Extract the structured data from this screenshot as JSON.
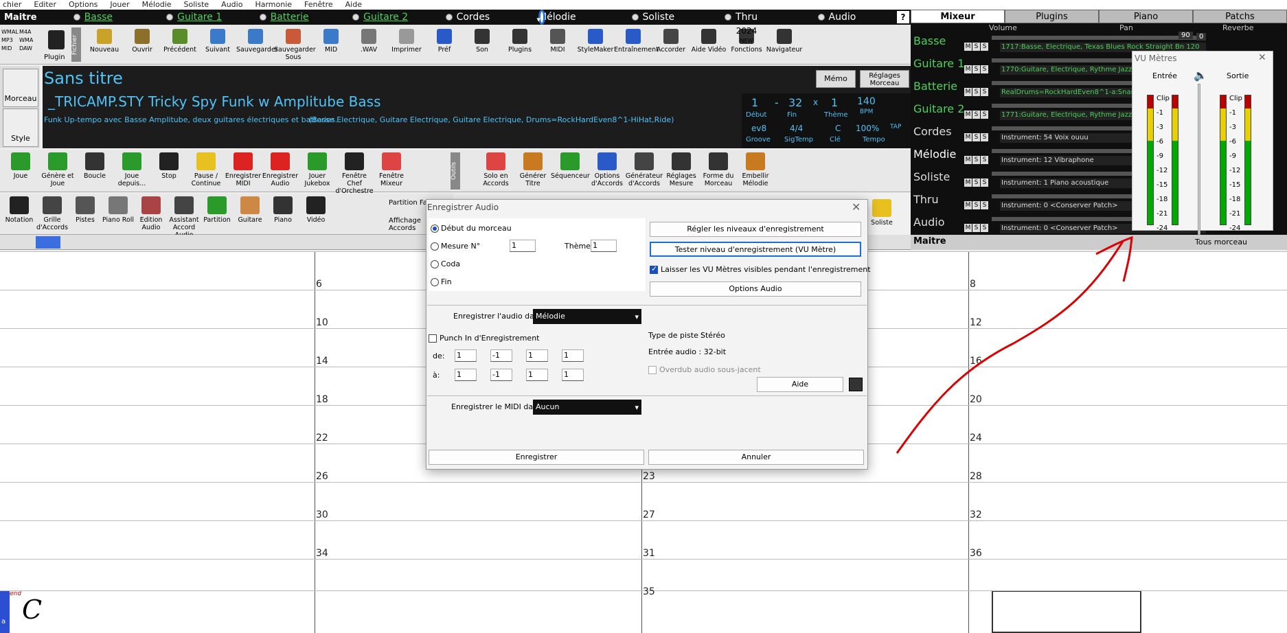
{
  "menu": [
    "chier",
    "Editer",
    "Options",
    "Jouer",
    "Mélodie",
    "Soliste",
    "Audio",
    "Harmonie",
    "Fenêtre",
    "Aide"
  ],
  "tracks": {
    "first": "Maitre",
    "items": [
      {
        "label": "Basse",
        "color": "green",
        "selected": false
      },
      {
        "label": "Guitare 1",
        "color": "green",
        "selected": false
      },
      {
        "label": "Batterie",
        "color": "green",
        "selected": false
      },
      {
        "label": "Guitare 2",
        "color": "green",
        "selected": false
      },
      {
        "label": "Cordes",
        "color": "white",
        "selected": false
      },
      {
        "label": "Mélodie",
        "color": "white",
        "selected": true
      },
      {
        "label": "Soliste",
        "color": "white",
        "selected": false
      },
      {
        "label": "Thru",
        "color": "white",
        "selected": false
      },
      {
        "label": "Audio",
        "color": "white",
        "selected": false
      }
    ],
    "help": "?"
  },
  "toolbar1": {
    "left": [
      "WMAL",
      "M4A",
      "MP3",
      "WMA",
      "MID",
      "DAW"
    ],
    "plugin_label": "Plugin",
    "fichier": "Fichier",
    "buttons": [
      "Nouveau",
      "Ouvrir",
      "Précédent",
      "Suivant",
      "Sauvegarder",
      "Sauvegarder Sous",
      "MID",
      ".WAV",
      "Imprimer",
      "Préf",
      "Son",
      "Plugins",
      "MIDI",
      "StyleMaker",
      "Entraînement",
      "Accorder",
      "Aide Vidéo",
      "Fonctions",
      "Navigateur"
    ],
    "fonctions_year": "2024",
    "fonctions_new": "NEW"
  },
  "song": {
    "title": "Sans titre",
    "style": "_TRICAMP.STY Tricky Spy Funk w Amplitube Bass",
    "desc": "Funk Up-tempo avec Basse Amplitube, deux guitares électriques et batteries.",
    "desc2": "(Basse Electrique, Guitare Electrique, Guitare Electrique, Drums=RockHardEven8^1-HiHat,Ride)",
    "memo": "Mémo",
    "reglages": "Réglages Morceau",
    "start": "1",
    "dash": "-",
    "end": "32",
    "x": "x",
    "theme_count": "1",
    "start_label": "Début",
    "end_label": "Fin",
    "theme_label": "Thème",
    "groove": "ev8",
    "sig": "4/4",
    "key": "C",
    "groove_label": "Groove",
    "sig_label": "SigTemp",
    "key_label": "Clé",
    "tempo": "140",
    "bpm": "BPM",
    "percent": "100%",
    "tap": "TAP",
    "tempo_label": "Tempo"
  },
  "sidebar": {
    "morceau": "Morceau",
    "style": "Style"
  },
  "toolbar2": [
    "Joue",
    "Génère et Joue",
    "Boucle",
    "Joue depuis...",
    "Stop",
    "Pause / Continue",
    "Enregistrer MIDI",
    "Enregistrer Audio",
    "Jouer Jukebox",
    "Fenêtre Chef d'Orchestre",
    "Fenêtre Mixeur",
    "Outils",
    "Solo en Accords",
    "Générer Titre",
    "Séquenceur",
    "Options d'Accords",
    "Générateur d'Accords",
    "Réglages Mesure",
    "Forme du Morceau",
    "Embellir Mélodie"
  ],
  "toolbar3": [
    "Notation",
    "Grille d'Accords",
    "Pistes",
    "Piano Roll",
    "Edition Audio",
    "Assistant Accord Audio",
    "Partition",
    "Guitare",
    "Piano",
    "Vidéo",
    "Partition Fal",
    "Affichage Accords",
    "Soliste"
  ],
  "grid": {
    "bars_col1": [
      "6",
      "10",
      "14",
      "18",
      "22",
      "26",
      "30",
      "34"
    ],
    "bars_col3": [
      "8",
      "12",
      "16",
      "20",
      "24",
      "28",
      "32",
      "36"
    ],
    "bars_mid": [
      "23",
      "27",
      "31",
      "35"
    ],
    "end_marker": "end",
    "chord": "C",
    "corner": "a"
  },
  "mixer": {
    "tabs": [
      "Mixeur",
      "Plugins",
      "Piano",
      "Patchs"
    ],
    "headers": [
      "Volume",
      "Pan",
      "Reverbe"
    ],
    "rows": [
      {
        "name": "Basse",
        "color": "#4cd15a",
        "vol": "90",
        "inst": "1717:Basse, Electrique, Texas Blues Rock Straight Bn 120"
      },
      {
        "name": "Guitare 1",
        "color": "#4cd15a",
        "vol": "90",
        "inst": "1770:Guitare, Electrique, Rythme Jazz"
      },
      {
        "name": "Batterie",
        "color": "#4cd15a",
        "vol": "90",
        "inst": "RealDrums=RockHardEven8^1-a:Snare"
      },
      {
        "name": "Guitare 2",
        "color": "#4cd15a",
        "vol": "90",
        "inst": "1771:Guitare, Electrique, Rythme Jazz"
      },
      {
        "name": "Cordes",
        "color": "#dddddd",
        "vol": "90",
        "inst": "Instrument: 54 Voix ouuu"
      },
      {
        "name": "Mélodie",
        "color": "#ffffff",
        "vol": "90",
        "inst": "Instrument: 12 Vibraphone"
      },
      {
        "name": "Soliste",
        "color": "#dddddd",
        "vol": "90",
        "inst": "Instrument: 1 Piano acoustique"
      },
      {
        "name": "Thru",
        "color": "#dddddd",
        "vol": "90",
        "inst": "Instrument: 0 <Conserver Patch>"
      },
      {
        "name": "Audio",
        "color": "#dddddd",
        "vol": "90",
        "inst": "Instrument: 0 <Conserver Patch>"
      }
    ],
    "master": "Maitre",
    "master_extra": "Tous morceau",
    "rev_val": "0",
    "msh": [
      "M",
      "S",
      "S"
    ]
  },
  "vu": {
    "title": "VU Mètres",
    "close": "✕",
    "in_label": "Entrée",
    "out_label": "Sortie",
    "ticks": [
      "Clip",
      "-1",
      "-3",
      "-6",
      "-9",
      "-12",
      "-15",
      "-18",
      "-21",
      "-24"
    ]
  },
  "dialog": {
    "title": "Enregistrer Audio",
    "close": "✕",
    "r_debut": "Début du morceau",
    "r_mesure": "Mesure N°",
    "mesure_val": "1",
    "theme_lbl": "Thème",
    "theme_val": "1",
    "r_coda": "Coda",
    "r_fin": "Fin",
    "btn_regler": "Régler les niveaux d'enregistrement",
    "btn_tester": "Tester niveau d'enregistrement (VU Mètre)",
    "chk_laisser": "Laisser les VU Mètres visibles pendant l'enregistrement",
    "btn_options": "Options Audio",
    "audio_in_lbl": "Enregistrer l'audio dans:",
    "audio_in_val": "Mélodie",
    "punch": "Punch In d'Enregistrement",
    "de": "de:",
    "a": "à:",
    "de_vals": [
      "1",
      "-1",
      "1",
      "1"
    ],
    "a_vals": [
      "1",
      "-1",
      "1",
      "1"
    ],
    "type_piste": "Type de piste :",
    "type_val": "Stéréo",
    "entree": "Entrée audio : 32-bit",
    "overdub": "Overdub audio sous-jacent",
    "aide": "Aide",
    "midi_lbl": "Enregistrer le MIDI dans:",
    "midi_val": "Aucun",
    "btn_enr": "Enregistrer",
    "btn_ann": "Annuler"
  }
}
